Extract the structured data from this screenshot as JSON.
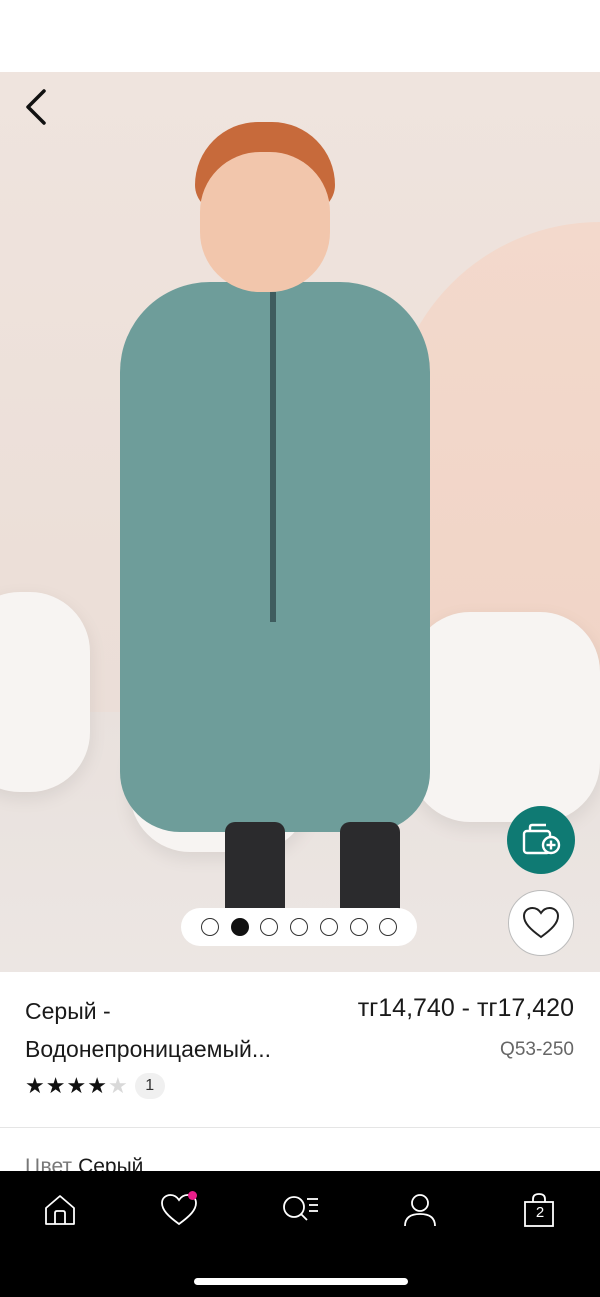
{
  "gallery": {
    "image_alt": "",
    "dots_count": 7,
    "active_dot_index": 1
  },
  "product": {
    "title_line1": "Серый -",
    "title_line2": "Водонепроницаемый...",
    "price": "тг14,740 - тг17,420",
    "sku": "Q53-250",
    "rating_stars": 4,
    "rating_max": 5,
    "review_count": "1",
    "color_label": "Цвет",
    "color_value": "Серый"
  },
  "tabbar": {
    "bag_count": "2",
    "favourites_has_badge": true
  },
  "colors": {
    "accent_teal": "#0f7a73",
    "badge_pink": "#e91e8a",
    "tabbar_bg": "#000000"
  },
  "icons": [
    "back-arrow-icon",
    "wallet-add-icon",
    "heart-icon",
    "home-icon",
    "heart-icon",
    "search-list-icon",
    "account-icon",
    "bag-icon"
  ]
}
